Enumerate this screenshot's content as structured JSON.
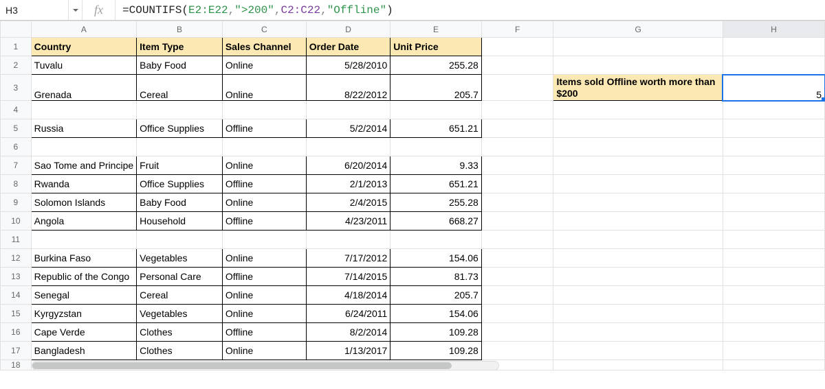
{
  "name_box": "H3",
  "formula": {
    "eq": "=",
    "func": "COUNTIFS",
    "open": "(",
    "r1": "E2:E22",
    "c1": ",",
    "s1": "\">200\"",
    "c2": ",",
    "r2": "C2:C22",
    "c3": ",",
    "s2": "\"Offline\"",
    "close": ")"
  },
  "col_headers": [
    "A",
    "B",
    "C",
    "D",
    "E",
    "F",
    "G",
    "H"
  ],
  "row_headers": [
    "1",
    "2",
    "3",
    "4",
    "5",
    "6",
    "7",
    "8",
    "9",
    "10",
    "11",
    "12",
    "13",
    "14",
    "15",
    "16",
    "17",
    "18"
  ],
  "headers": {
    "A": "Country",
    "B": "Item Type",
    "C": "Sales Channel",
    "D": "Order Date",
    "E": "Unit Price"
  },
  "side": {
    "label": "Items sold Offline worth more than $200",
    "value": "5"
  },
  "rows": [
    {
      "A": "Tuvalu",
      "B": "Baby Food",
      "C": "Online",
      "D": "5/28/2010",
      "E": "255.28"
    },
    {
      "A": "Grenada",
      "B": "Cereal",
      "C": "Online",
      "D": "8/22/2012",
      "E": "205.7"
    },
    {
      "A": "",
      "B": "",
      "C": "",
      "D": "",
      "E": ""
    },
    {
      "A": "Russia",
      "B": "Office Supplies",
      "C": "Offline",
      "D": "5/2/2014",
      "E": "651.21"
    },
    {
      "A": "",
      "B": "",
      "C": "",
      "D": "",
      "E": ""
    },
    {
      "A": "Sao Tome and Principe",
      "B": "Fruit",
      "C": "Online",
      "D": "6/20/2014",
      "E": "9.33"
    },
    {
      "A": "Rwanda",
      "B": "Office Supplies",
      "C": "Offline",
      "D": "2/1/2013",
      "E": "651.21"
    },
    {
      "A": "Solomon Islands",
      "B": "Baby Food",
      "C": "Online",
      "D": "2/4/2015",
      "E": "255.28"
    },
    {
      "A": "Angola",
      "B": "Household",
      "C": "Offline",
      "D": "4/23/2011",
      "E": "668.27"
    },
    {
      "A": "",
      "B": "",
      "C": "",
      "D": "",
      "E": ""
    },
    {
      "A": "Burkina Faso",
      "B": "Vegetables",
      "C": "Online",
      "D": "7/17/2012",
      "E": "154.06"
    },
    {
      "A": "Republic of the Congo",
      "B": "Personal Care",
      "C": "Offline",
      "D": "7/14/2015",
      "E": "81.73"
    },
    {
      "A": "Senegal",
      "B": "Cereal",
      "C": "Online",
      "D": "4/18/2014",
      "E": "205.7"
    },
    {
      "A": "Kyrgyzstan",
      "B": "Vegetables",
      "C": "Online",
      "D": "6/24/2011",
      "E": "154.06"
    },
    {
      "A": "Cape Verde",
      "B": "Clothes",
      "C": "Offline",
      "D": "8/2/2014",
      "E": "109.28"
    },
    {
      "A": "Bangladesh",
      "B": "Clothes",
      "C": "Online",
      "D": "1/13/2017",
      "E": "109.28"
    }
  ],
  "chart_data": {
    "type": "table",
    "title": "",
    "columns": [
      "Country",
      "Item Type",
      "Sales Channel",
      "Order Date",
      "Unit Price"
    ],
    "rows": [
      [
        "Tuvalu",
        "Baby Food",
        "Online",
        "5/28/2010",
        255.28
      ],
      [
        "Grenada",
        "Cereal",
        "Online",
        "8/22/2012",
        205.7
      ],
      [
        "Russia",
        "Office Supplies",
        "Offline",
        "5/2/2014",
        651.21
      ],
      [
        "Sao Tome and Principe",
        "Fruit",
        "Online",
        "6/20/2014",
        9.33
      ],
      [
        "Rwanda",
        "Office Supplies",
        "Offline",
        "2/1/2013",
        651.21
      ],
      [
        "Solomon Islands",
        "Baby Food",
        "Online",
        "2/4/2015",
        255.28
      ],
      [
        "Angola",
        "Household",
        "Offline",
        "4/23/2011",
        668.27
      ],
      [
        "Burkina Faso",
        "Vegetables",
        "Online",
        "7/17/2012",
        154.06
      ],
      [
        "Republic of the Congo",
        "Personal Care",
        "Offline",
        "7/14/2015",
        81.73
      ],
      [
        "Senegal",
        "Cereal",
        "Online",
        "4/18/2014",
        205.7
      ],
      [
        "Kyrgyzstan",
        "Vegetables",
        "Online",
        "6/24/2011",
        154.06
      ],
      [
        "Cape Verde",
        "Clothes",
        "Offline",
        "8/2/2014",
        109.28
      ],
      [
        "Bangladesh",
        "Clothes",
        "Online",
        "1/13/2017",
        109.28
      ]
    ],
    "computed": {
      "label": "Items sold Offline worth more than $200",
      "formula": "=COUNTIFS(E2:E22,\">200\",C2:C22,\"Offline\")",
      "result": 5
    }
  }
}
